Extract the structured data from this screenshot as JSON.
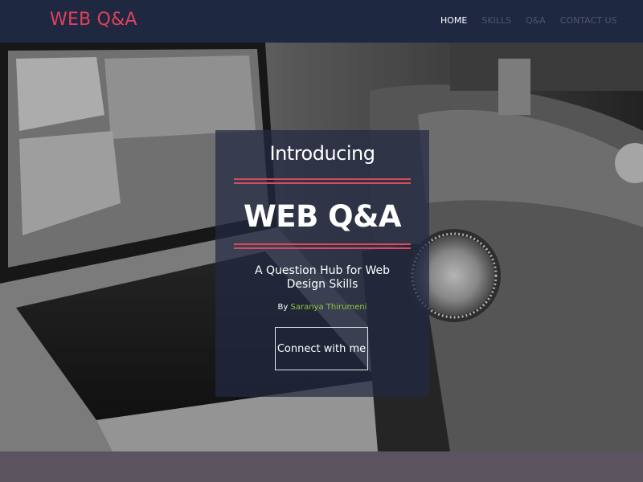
{
  "navbar": {
    "brand": "WEB Q&A",
    "items": [
      {
        "label": "HOME",
        "active": true
      },
      {
        "label": "SKILLS",
        "active": false
      },
      {
        "label": "Q&A",
        "active": false
      },
      {
        "label": "CONTACT US",
        "active": false
      }
    ]
  },
  "hero": {
    "intro": "Introducing",
    "title": "WEB Q&A",
    "subtitle": "A Question Hub for Web Design Skills",
    "by_prefix": "By",
    "author": "Saranya Thirumeni",
    "cta_label": "Connect with me"
  },
  "colors": {
    "navbar_bg": "#1f2841",
    "brand": "#e0405b",
    "accent_lines": "#d94a5f",
    "author": "#8dc63f",
    "footer_band": "#5b535e"
  }
}
